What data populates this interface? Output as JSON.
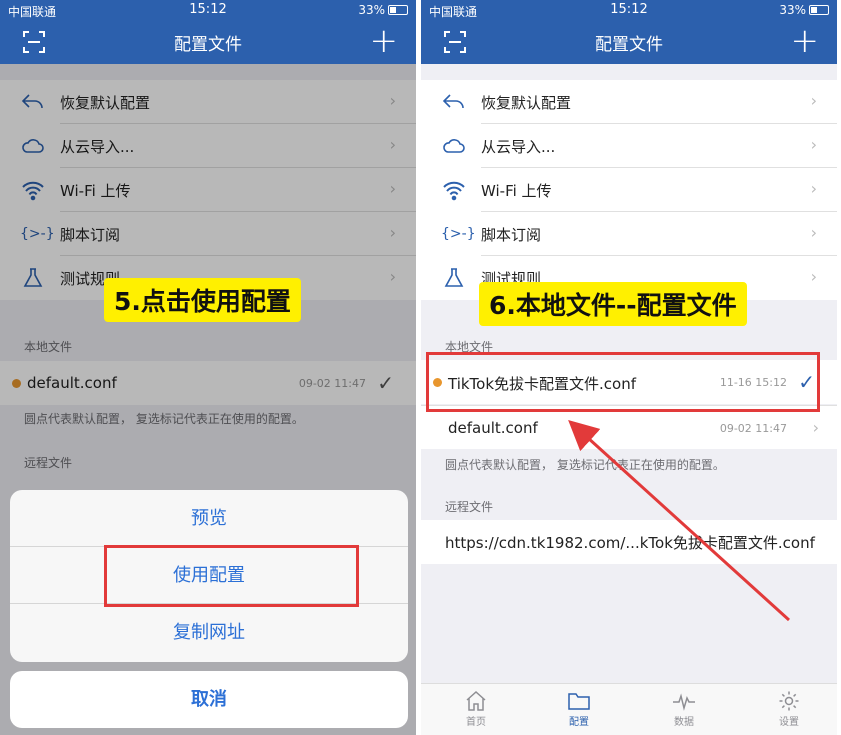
{
  "colors": {
    "nav": "#2c60ad",
    "accent": "#2c70d6",
    "highlight": "#e23a3a",
    "callout": "#fff000",
    "dot": "#e8962e"
  },
  "left": {
    "status": {
      "carrier": "中国联通",
      "time": "15:12",
      "battery": "33%"
    },
    "nav_title": "配置文件",
    "menu": [
      {
        "icon": "undo-arrow-icon",
        "label": "恢复默认配置"
      },
      {
        "icon": "cloud-icon",
        "label": "从云导入..."
      },
      {
        "icon": "wifi-icon",
        "label": "Wi-Fi 上传"
      },
      {
        "icon": "script-braces-icon",
        "label": "脚本订阅"
      },
      {
        "icon": "flask-icon",
        "label": "测试规则"
      }
    ],
    "local_header": "本地文件",
    "files": [
      {
        "name": "default.conf",
        "date": "09-02 11:47",
        "is_default": true,
        "selected": true
      }
    ],
    "note": "圆点代表默认配置， 复选标记代表正在使用的配置。",
    "remote_header": "远程文件",
    "sheet": {
      "preview": "预览",
      "use_config": "使用配置",
      "copy_url": "复制网址",
      "cancel": "取消"
    },
    "callout": "5.点击使用配置"
  },
  "right": {
    "status": {
      "carrier": "中国联通",
      "time": "15:12",
      "battery": "33%"
    },
    "nav_title": "配置文件",
    "menu": [
      {
        "icon": "undo-arrow-icon",
        "label": "恢复默认配置"
      },
      {
        "icon": "cloud-icon",
        "label": "从云导入..."
      },
      {
        "icon": "wifi-icon",
        "label": "Wi-Fi 上传"
      },
      {
        "icon": "script-braces-icon",
        "label": "脚本订阅"
      },
      {
        "icon": "flask-icon",
        "label": "测试规则"
      }
    ],
    "local_header": "本地文件",
    "files": [
      {
        "name": "TikTok免拔卡配置文件.conf",
        "date": "11-16 15:12",
        "is_default": true,
        "selected": true
      },
      {
        "name": "default.conf",
        "date": "09-02 11:47",
        "is_default": false,
        "selected": false
      }
    ],
    "note": "圆点代表默认配置， 复选标记代表正在使用的配置。",
    "remote_header": "远程文件",
    "remote_url": "https://cdn.tk1982.com/...kTok免拔卡配置文件.conf",
    "tabs": [
      {
        "icon": "home-icon",
        "label": "首页"
      },
      {
        "icon": "folder-icon",
        "label": "配置"
      },
      {
        "icon": "pulse-icon",
        "label": "数据"
      },
      {
        "icon": "gear-icon",
        "label": "设置"
      }
    ],
    "callout": "6.本地文件--配置文件"
  }
}
